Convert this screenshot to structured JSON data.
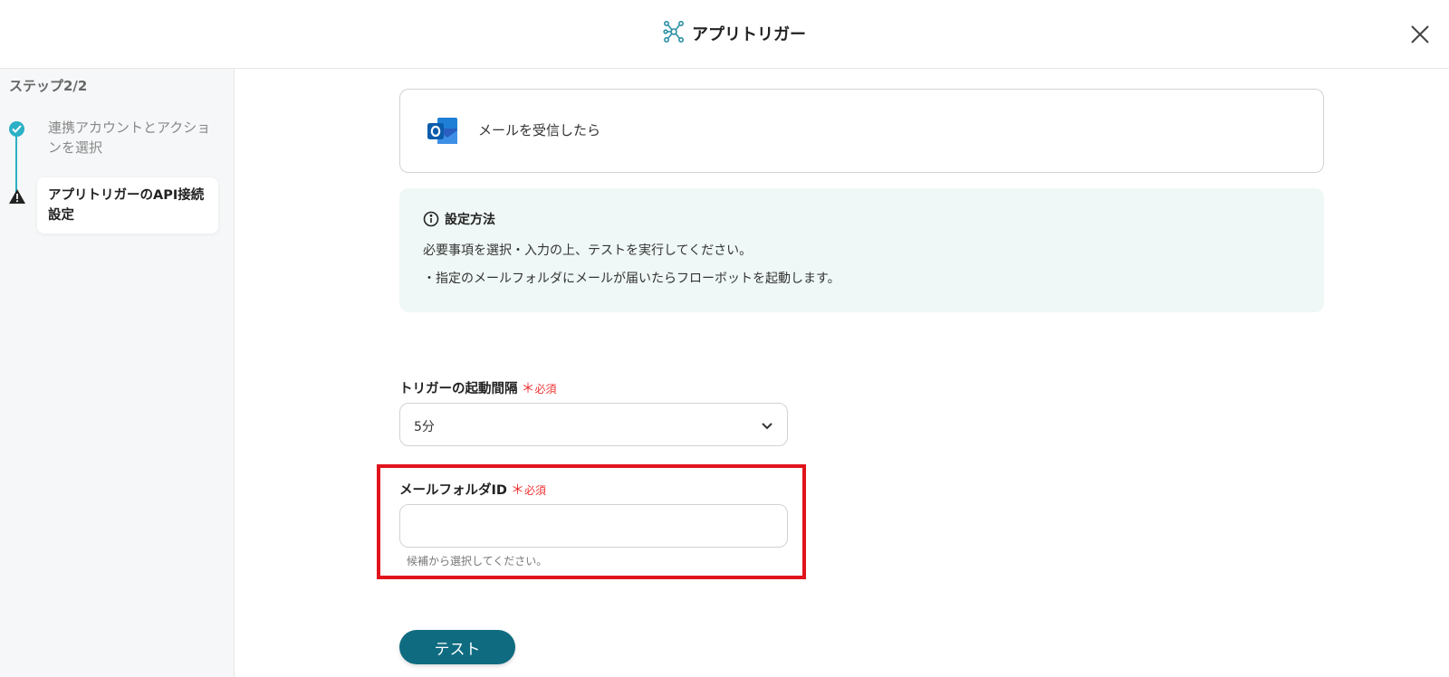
{
  "header": {
    "title": "アプリトリガー",
    "icon": "trigger-network-icon"
  },
  "sidebar": {
    "step_count": "ステップ2/2",
    "steps": [
      {
        "label": "連携アカウントとアクションを選択",
        "status": "completed",
        "icon": "check-circle-icon"
      },
      {
        "label": "アプリトリガーのAPI接続設定",
        "status": "warning",
        "icon": "warning-triangle-icon"
      }
    ]
  },
  "app_card": {
    "app_icon": "outlook-icon",
    "trigger_name": "メールを受信したら"
  },
  "info_box": {
    "heading": "設定方法",
    "line1": "必要事項を選択・入力の上、テストを実行してください。",
    "line2": "・指定のメールフォルダにメールが届いたらフローボットを起動します。"
  },
  "fields": {
    "interval": {
      "label": "トリガーの起動間隔",
      "required_mark": "＊",
      "required_text": "必須",
      "value": "5分"
    },
    "folder_id": {
      "label": "メールフォルダID",
      "required_mark": "＊",
      "required_text": "必須",
      "value": "",
      "hint": "候補から選択してください。"
    }
  },
  "test_button": {
    "label": "テスト"
  },
  "colors": {
    "accent": "#2bb0c6",
    "button": "#0f6b80",
    "highlight": "#e0141c",
    "required": "#e33333",
    "info_bg": "#eff8f6"
  }
}
